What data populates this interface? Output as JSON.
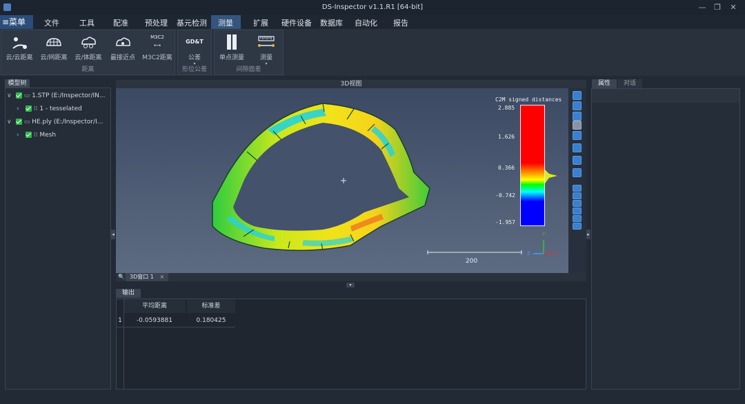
{
  "window": {
    "title": "DS-Inspector v1.1.R1 [64-bit]",
    "minimize": "—",
    "restore": "❐",
    "close": "✕"
  },
  "menubar": {
    "main": "≡菜单",
    "items": [
      "文件",
      "工具",
      "配准",
      "预处理",
      "基元检测",
      "测量",
      "扩展",
      "硬件设备",
      "数据库",
      "自动化",
      "报告"
    ],
    "active": "测量"
  },
  "ribbon": {
    "groups": [
      {
        "label": "距离",
        "buttons": [
          {
            "label": "云/云距离",
            "icon": "cloud-cloud-distance-icon"
          },
          {
            "label": "云/网距离",
            "icon": "cloud-mesh-distance-icon"
          },
          {
            "label": "云/体距离",
            "icon": "cloud-volume-distance-icon"
          },
          {
            "label": "最接近点",
            "icon": "closest-point-icon"
          },
          {
            "label": "M3C2距离",
            "icon": "m3c2-distance-icon",
            "icon_text": "M3C2"
          }
        ]
      },
      {
        "label": "形位公差",
        "buttons": [
          {
            "label": "公差",
            "icon": "gdt-icon",
            "icon_text": "GD&T"
          }
        ]
      },
      {
        "label": "间隙面差",
        "buttons": [
          {
            "label": "单点测量",
            "icon": "single-point-measure-icon"
          },
          {
            "label": "测量",
            "icon": "ruler-icon"
          }
        ]
      }
    ]
  },
  "model_tree": {
    "tab": "模型树",
    "items": [
      {
        "label": "1.STP (E:/Inspector/IN...",
        "level": 0,
        "checked": true
      },
      {
        "label": "1 - tesselated",
        "level": 1,
        "checked": true
      },
      {
        "label": "HE.ply (E:/Inspector/I...",
        "level": 0,
        "checked": true
      },
      {
        "label": "Mesh",
        "level": 1,
        "checked": true
      }
    ]
  },
  "viewport": {
    "title": "3D视图",
    "window_tab": "3D窗口 1",
    "tab_close": "×",
    "scale_label": "200",
    "axis_labels": {
      "x": "X",
      "y": "Y",
      "z": "Z"
    }
  },
  "colorbar": {
    "title": "C2M signed distances",
    "ticks": [
      "2.885",
      "1.626",
      "0.366",
      "-0.742",
      "-1.957"
    ],
    "colors": [
      "#ff0000",
      "#ffff00",
      "#00ff00",
      "#00ffff",
      "#0000ff"
    ]
  },
  "properties": {
    "tabs": [
      "属性",
      "对话"
    ]
  },
  "output": {
    "tab": "输出",
    "columns": [
      "平均距离",
      "标准差"
    ],
    "rows": [
      {
        "index": "1",
        "values": [
          "-0.0593881",
          "0.180425"
        ]
      }
    ]
  }
}
